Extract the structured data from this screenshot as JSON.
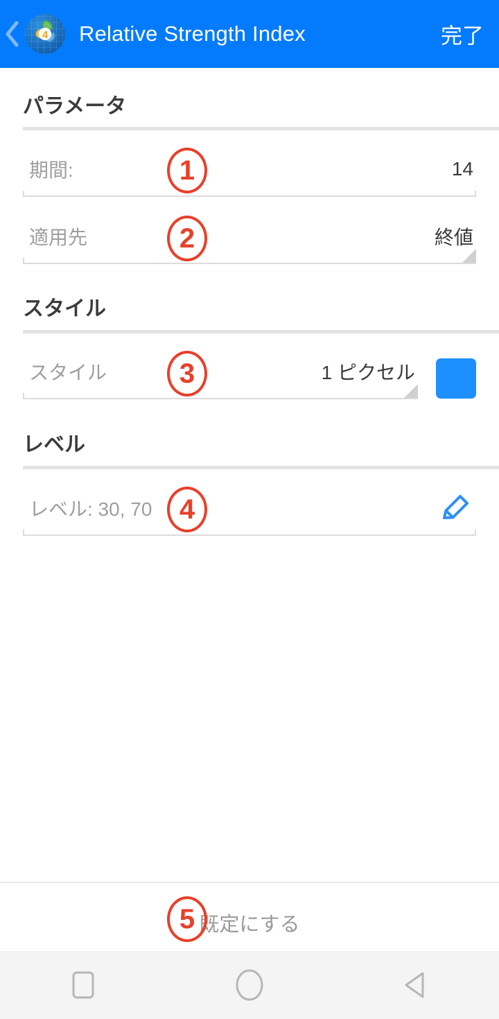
{
  "appbar": {
    "back_icon": "chevron-left-icon",
    "app_icon": "metatrader4-app-icon",
    "title": "Relative Strength Index",
    "done_label": "完了",
    "bg_color": "#047BFC"
  },
  "sections": [
    {
      "title": "パラメータ"
    },
    {
      "title": "スタイル"
    },
    {
      "title": "レベル"
    }
  ],
  "fields": {
    "period": {
      "label": "期間:",
      "value": "14"
    },
    "apply_to": {
      "label": "適用先",
      "value": "終値",
      "spinner_icon": "spinner-triangle-icon"
    },
    "style": {
      "label": "スタイル",
      "value": "1 ピクセル",
      "spinner_icon": "spinner-triangle-icon",
      "color_swatch": "#1E8FFF",
      "color_swatch_name": "color-swatch"
    },
    "levels": {
      "label": "レベル: 30, 70",
      "edit_icon": "pencil-edit-icon",
      "edit_icon_color": "#2E90F5"
    }
  },
  "bottom": {
    "default_label": "既定にする"
  },
  "navbar": {
    "recent_icon": "square-recents-icon",
    "home_icon": "circle-home-icon",
    "back_icon": "triangle-back-icon"
  },
  "annotations": [
    {
      "number": "1",
      "target": "period-field"
    },
    {
      "number": "2",
      "target": "apply-to-field"
    },
    {
      "number": "3",
      "target": "style-field"
    },
    {
      "number": "4",
      "target": "levels-field"
    },
    {
      "number": "5",
      "target": "set-default-button"
    }
  ]
}
